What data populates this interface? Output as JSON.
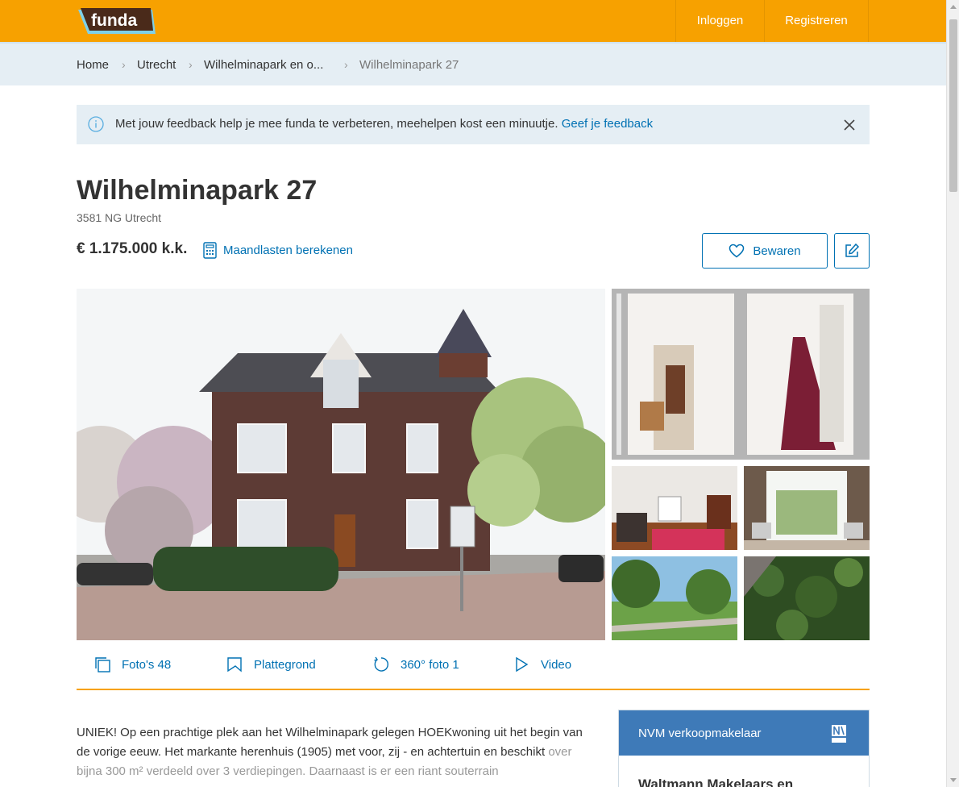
{
  "header": {
    "logo_text": "funda",
    "login_label": "Inloggen",
    "register_label": "Registreren"
  },
  "breadcrumb": {
    "items": [
      "Home",
      "Utrecht",
      "Wilhelminapark en o...",
      "Wilhelminapark 27"
    ]
  },
  "feedback": {
    "text": "Met jouw feedback help je mee funda te verbeteren, meehelpen kost een minuutje.",
    "link": "Geef je feedback"
  },
  "listing": {
    "title": "Wilhelminapark 27",
    "address": "3581 NG Utrecht",
    "price": "€ 1.175.000 k.k.",
    "calc_label": "Maandlasten berekenen",
    "save_label": "Bewaren"
  },
  "media": {
    "photos": "Foto's 48",
    "floorplan": "Plattegrond",
    "photo360": "360° foto 1",
    "video": "Video"
  },
  "description": {
    "text": "UNIEK! Op een prachtige plek aan het Wilhelminapark gelegen HOEKwoning uit het begin van de vorige eeuw. Het markante herenhuis (1905) met voor, zij - en achtertuin en beschikt",
    "faded": "over bijna 300 m² verdeeld over 3 verdiepingen. Daarnaast is er een riant souterrain"
  },
  "broker": {
    "heading": "NVM verkoopmakelaar",
    "name": "Waltmann Makelaars en"
  },
  "colors": {
    "brand_orange": "#f7a100",
    "link_blue": "#0071b3",
    "broker_blue": "#3e7ab8",
    "light_bg": "#e5eef4"
  }
}
